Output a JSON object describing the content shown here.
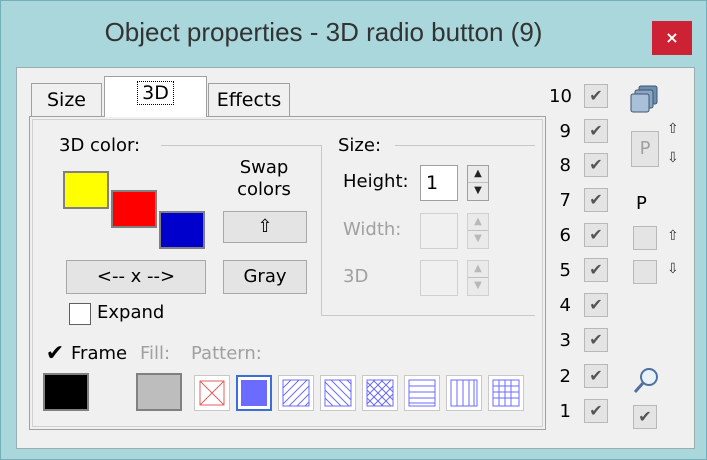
{
  "window": {
    "title": "Object properties - 3D radio button (9)",
    "close_label": "×",
    "background": "#a9d7dc"
  },
  "tabs": [
    {
      "label": "Size"
    },
    {
      "label": "3D"
    },
    {
      "label": "Effects"
    }
  ],
  "color3d": {
    "heading": "3D color:",
    "swatches": [
      "#ffff00",
      "#ff0000",
      "#0000cc"
    ],
    "swap_label_line1": "Swap",
    "swap_label_line2": "colors",
    "swap_button_icon": "arrow-up-icon",
    "swap_button_glyph": "⇧",
    "xchg_button_label": "<-- x -->",
    "gray_button_label": "Gray",
    "expand_label": "Expand",
    "expand_checked": false
  },
  "size": {
    "heading": "Size:",
    "height_label": "Height:",
    "height_value": "1",
    "width_label": "Width:",
    "width_value": "",
    "d3_label": "3D",
    "d3_value": ""
  },
  "frame": {
    "label": "Frame",
    "checked": true,
    "check_glyph": "✔",
    "color": "#000000",
    "fill_label": "Fill:",
    "fill_color": "#bdbdbd",
    "pattern_label": "Pattern:",
    "patterns": [
      "none",
      "solid",
      "diagonal-up",
      "diagonal-down",
      "cross-diagonal",
      "horizontal",
      "vertical",
      "grid"
    ],
    "selected_pattern": "solid",
    "pattern_color": "#6b6bff"
  },
  "right_panel": {
    "layers": [
      {
        "num": "10",
        "checked": true
      },
      {
        "num": "9",
        "checked": true
      },
      {
        "num": "8",
        "checked": true
      },
      {
        "num": "7",
        "checked": true
      },
      {
        "num": "6",
        "checked": true
      },
      {
        "num": "5",
        "checked": true
      },
      {
        "num": "4",
        "checked": true
      },
      {
        "num": "3",
        "checked": true
      },
      {
        "num": "2",
        "checked": true
      },
      {
        "num": "1",
        "checked": true
      }
    ],
    "layers_icon": "layers-icon",
    "p_box_label": "P",
    "p_label": "P",
    "arrow_up_icon": "arrow-up-icon",
    "arrow_down_icon": "arrow-down-icon",
    "arrow_up_glyph": "⇧",
    "arrow_down_glyph": "⇩",
    "magnifier_icon": "magnifier-icon",
    "check_glyph": "✔"
  }
}
